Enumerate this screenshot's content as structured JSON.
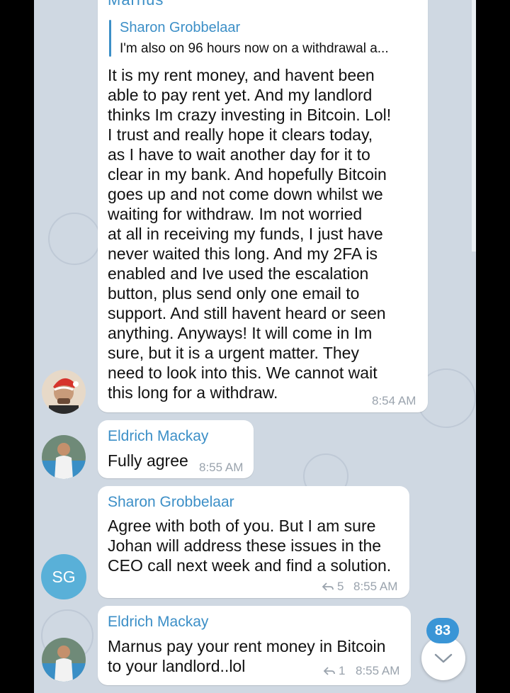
{
  "partial_sender": "Marnus",
  "messages": [
    {
      "sender": "",
      "reply_to": {
        "name": "Sharon Grobbelaar",
        "text": "I'm also on 96 hours now on a withdrawal a..."
      },
      "text": "It is my rent money, and havent been\nable to pay rent yet. And my landlord\nthinks Im crazy investing in Bitcoin. Lol!\nI trust and really hope it clears today,\nas I have to wait another day for it to\nclear in my bank. And hopefully Bitcoin\ngoes up and not come down whilst we\nwaiting for withdraw. Im not worried\nat all in receiving my funds, I just have\nnever waited this long. And my 2FA is\nenabled and Ive used the escalation\nbutton, plus send only one email to\nsupport. And still havent heard or seen\nanything. Anyways! It will come in Im\nsure, but it is a urgent matter. They\nneed to look into this. We cannot wait\nthis long for a withdraw.",
      "time": "8:54 AM"
    },
    {
      "sender": "Eldrich Mackay",
      "text": "Fully agree",
      "time": "8:55 AM"
    },
    {
      "sender": "Sharon Grobbelaar",
      "text": "Agree with both of you. But I am sure\nJohan will address these issues in the\nCEO call next week and find a solution.",
      "replies": "5",
      "time": "8:55 AM"
    },
    {
      "sender": "Eldrich Mackay",
      "text": "Marnus pay your rent money in Bitcoin\nto your landlord..lol",
      "replies": "1",
      "time": "8:55 AM"
    }
  ],
  "avatars": {
    "sg_initials": "SG"
  },
  "unread_badge": "83",
  "icons": {
    "scroll_down": "chevron-down-icon",
    "reply": "reply-arrow-icon"
  },
  "colors": {
    "accent": "#3c8fc7",
    "background": "#cfd8e2",
    "badge": "#3a95d6"
  }
}
